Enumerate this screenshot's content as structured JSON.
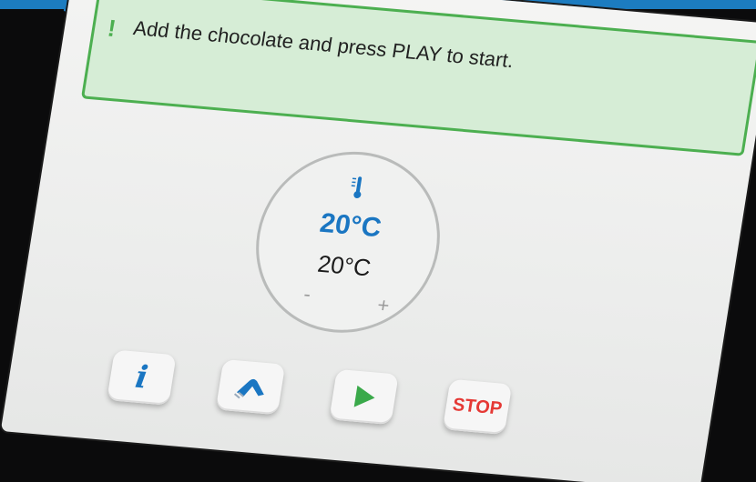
{
  "alert": {
    "mark": "!",
    "message": "Add the chocolate and press PLAY to start."
  },
  "temperature": {
    "setpoint": "20°C",
    "actual": "20°C",
    "decrease_label": "-",
    "increase_label": "+"
  },
  "buttons": {
    "info_label": "i",
    "stop_label": "STOP"
  },
  "colors": {
    "accent_blue": "#1c7cc0",
    "alert_green": "#4caf50",
    "alert_bg": "#d6edd6",
    "play_green": "#3aa94a",
    "stop_red": "#e53935"
  },
  "icons": [
    "info-icon",
    "pour-icon",
    "play-icon",
    "thermometer-icon"
  ]
}
